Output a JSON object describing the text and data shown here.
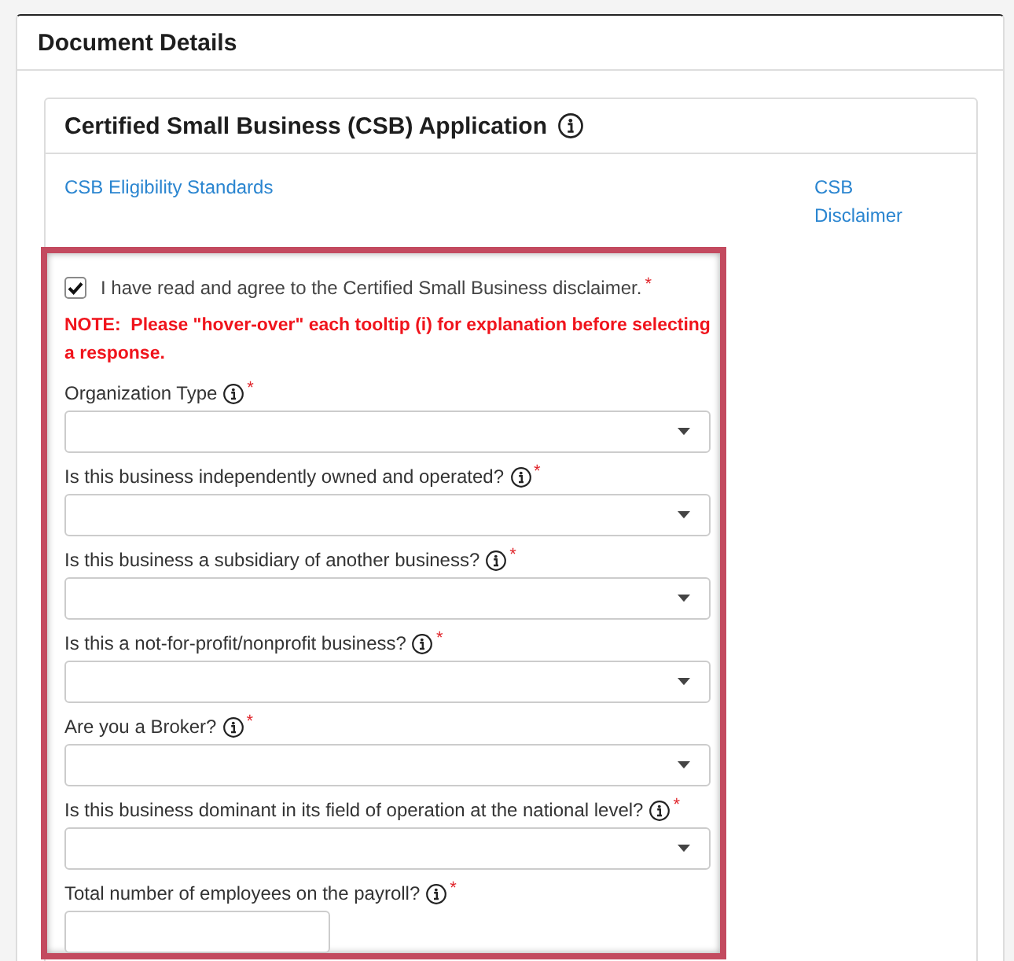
{
  "panel": {
    "title": "Document Details"
  },
  "application": {
    "title": "Certified Small Business (CSB) Application",
    "links": [
      {
        "label": "CSB Eligibility Standards"
      },
      {
        "label": "CSB Disclaimer"
      }
    ],
    "agreement": {
      "label": "I have read and agree to the Certified Small Business disclaimer.",
      "required_mark": "*",
      "checked": true
    },
    "note": "NOTE:  Please \"hover-over\" each tooltip (i) for explanation before selecting a response.",
    "questions": [
      {
        "kind": "select",
        "label": "Organization Type",
        "required_mark": "*"
      },
      {
        "kind": "select",
        "label": "Is this business independently owned and operated?",
        "required_mark": "*"
      },
      {
        "kind": "select",
        "label": "Is this business a subsidiary of another business?",
        "required_mark": "*"
      },
      {
        "kind": "select",
        "label": "Is this a not-for-profit/nonprofit business?",
        "required_mark": "*"
      },
      {
        "kind": "select",
        "label": "Are you a Broker?",
        "required_mark": "*"
      },
      {
        "kind": "select",
        "label": "Is this business dominant in its field of operation at the national level?",
        "required_mark": "*"
      },
      {
        "kind": "text",
        "label": "Total number of employees on the payroll?",
        "required_mark": "*"
      }
    ]
  }
}
